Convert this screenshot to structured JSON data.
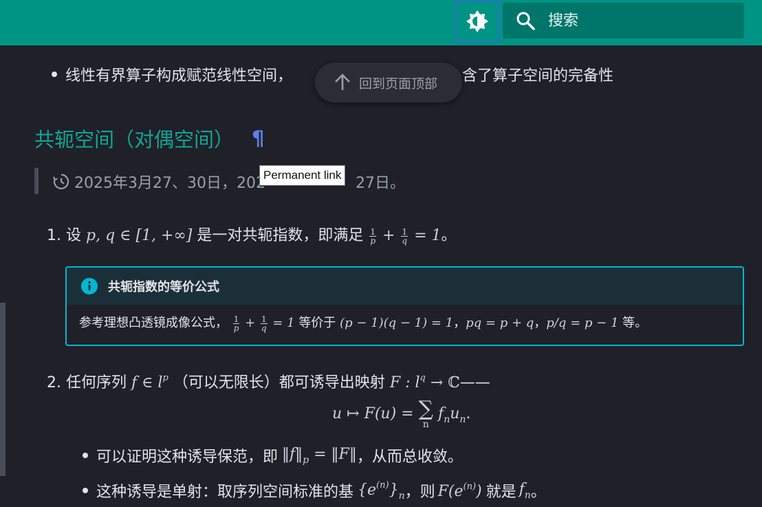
{
  "header": {
    "search_placeholder": "搜索",
    "theme_toggle_icon": "brightness-icon",
    "search_icon": "search-icon"
  },
  "content": {
    "bullet_top": "线性有界算子构成赋范线性空间，算子范数的定义包含了算子空间的完备性",
    "bullet_top_left": "线性有界算子构成赋范线性空间，",
    "bullet_top_right": "含了算子空间的完备性",
    "back_to_top": "回到页面顶部",
    "heading": "共轭空间（对偶空间）",
    "permalink": "¶",
    "tooltip": "Permanent link",
    "date": "2025年3月27、30日，2025年5月23~27日。",
    "date_left": "2025年3月27、30日，202",
    "date_right": "27日。",
    "item1": {
      "num": "1.",
      "pre": "设",
      "math_a": "p, q ∈ [1, +∞]",
      "mid": "是一对共轭指数，即满足",
      "frac1_num": "1",
      "frac1_den": "p",
      "plus": "+",
      "frac2_num": "1",
      "frac2_den": "q",
      "eq": "= 1",
      "end": "。"
    },
    "admonition": {
      "title": "共轭指数的等价公式",
      "body_pre": "参考理想凸透镜成像公式，",
      "f1n": "1",
      "f1d": "p",
      "plus": "+",
      "f2n": "1",
      "f2d": "q",
      "eq1": "= 1",
      "equiv": "等价于",
      "m1": "(p − 1)(q − 1) = 1",
      "comma1": "，",
      "m2": "pq = p + q",
      "comma2": "，",
      "m3": "p/q = p − 1",
      "end": "等。"
    },
    "item2": {
      "num": "2.",
      "pre": "任何序列",
      "math_a": "f ∈ l",
      "sup_a": "p",
      "mid": "（可以无限长）都可诱导出映射",
      "math_b": "F : l",
      "sup_b": "q",
      "math_b2": " → ℂ",
      "end": "——"
    },
    "display_eq": {
      "lhs": "u ↦ F(u) = ",
      "sum": "∑",
      "sum_sub": "n",
      "rhs": "f",
      "rhs_sub1": "n",
      "rhs2": "u",
      "rhs_sub2": "n",
      "dot": "."
    },
    "sub1": {
      "pre": "可以证明这种诱导保范，即",
      "m": "‖f‖",
      "m_sub": "p",
      "m2": " = ‖F‖",
      "end": "，从而总收敛。"
    },
    "sub2": {
      "pre": "这种诱导是单射：取序列空间标准的基",
      "m": "{e",
      "m_sup": "(n)",
      "m2": "}",
      "m_sub": "n",
      "mid": "，则",
      "m3": "F(e",
      "m3_sup": "(n)",
      "m4": ")",
      "mid2": "就是",
      "m5": "f",
      "m5_sub": "n",
      "end": "。"
    }
  }
}
